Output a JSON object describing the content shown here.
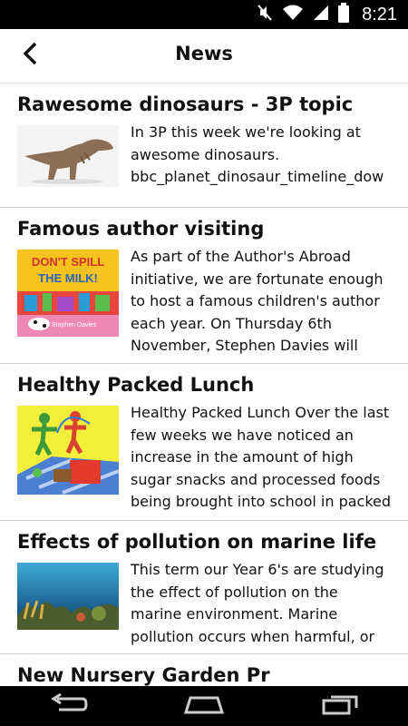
{
  "status": {
    "time": "8:21"
  },
  "header": {
    "title": "News"
  },
  "news": [
    {
      "title": "Rawesome dinosaurs - 3P topic",
      "excerpt": "In 3P this week we're looking at awesome dinosaurs. bbc_planet_dinosaur_timeline_dow",
      "thumb": "dinosaur"
    },
    {
      "title": "Famous author visiting",
      "excerpt": "As part of the Author's Abroad initiative, we are fortunate enough to host a famous children's author each year. On Thursday 6th November, Stephen Davies will visit",
      "thumb": "book-cover",
      "thumb_text": {
        "line1": "DON'T SPILL",
        "line2": "THE MILK!",
        "author": "Stephen Davies"
      }
    },
    {
      "title": "Healthy Packed Lunch",
      "excerpt": "Healthy Packed Lunch Over the last few weeks we have noticed an increase in the amount of high sugar snacks and processed foods being brought into school in packed",
      "thumb": "picnic"
    },
    {
      "title": "Effects of pollution on marine life",
      "excerpt": "This term our Year 6's are studying the effect of pollution on the marine environment. Marine pollution occurs when harmful, or",
      "thumb": "coral-reef"
    },
    {
      "title": "New Nursery Garden Pr",
      "excerpt": "",
      "thumb": ""
    }
  ],
  "colors": {
    "statusbar": "#000000",
    "navbar": "#000000",
    "divider": "#cfcfcf"
  }
}
